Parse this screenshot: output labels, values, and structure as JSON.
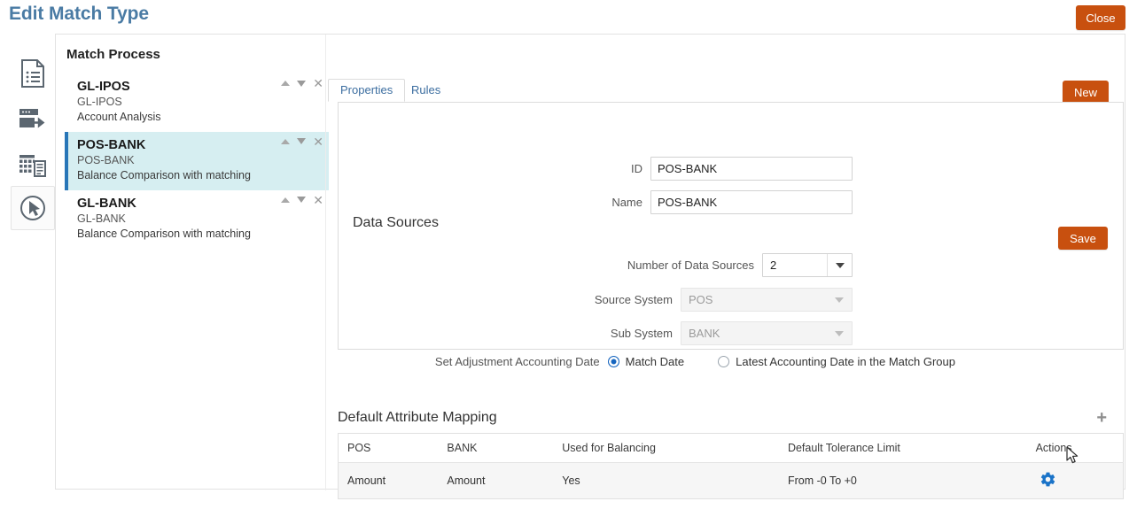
{
  "page": {
    "title": "Edit Match Type",
    "close_label": "Close"
  },
  "sidebar_rail": {
    "icons": [
      {
        "name": "document-list-icon"
      },
      {
        "name": "data-load-icon"
      },
      {
        "name": "grid-report-icon"
      },
      {
        "name": "cursor-target-icon"
      }
    ]
  },
  "match_process": {
    "heading": "Match Process",
    "new_label": "New",
    "items": [
      {
        "title": "GL-IPOS",
        "subtitle": "GL-IPOS",
        "description": "Account Analysis",
        "selected": false
      },
      {
        "title": "POS-BANK",
        "subtitle": "POS-BANK",
        "description": "Balance Comparison with matching",
        "selected": true
      },
      {
        "title": "GL-BANK",
        "subtitle": "GL-BANK",
        "description": "Balance Comparison with matching",
        "selected": false
      }
    ]
  },
  "tabs": [
    {
      "label": "Properties",
      "active": true
    },
    {
      "label": "Rules",
      "active": false
    }
  ],
  "properties": {
    "save_label": "Save",
    "id_label": "ID",
    "id_value": "POS-BANK",
    "name_label": "Name",
    "name_value": "POS-BANK",
    "data_sources_heading": "Data Sources",
    "number_of_data_sources_label": "Number of Data Sources",
    "number_of_data_sources_value": "2",
    "source_system_label": "Source System",
    "source_system_value": "POS",
    "sub_system_label": "Sub System",
    "sub_system_value": "BANK",
    "set_adjustment_label": "Set Adjustment Accounting Date",
    "radio_match_date": "Match Date",
    "radio_latest_accounting": "Latest Accounting Date in the Match Group",
    "selected_radio": "Match Date"
  },
  "default_attribute_mapping": {
    "title": "Default Attribute Mapping",
    "add_icon": "+",
    "columns": [
      "POS",
      "BANK",
      "Used for Balancing",
      "Default Tolerance Limit",
      "Actions"
    ],
    "rows": [
      {
        "pos": "Amount",
        "bank": "Amount",
        "used_for_balancing": "Yes",
        "default_tolerance_limit": "From -0 To +0",
        "action_icon": "gear-icon"
      }
    ]
  },
  "colors": {
    "accent_orange": "#c8500f",
    "title_blue": "#4a7ba4",
    "selection_cyan": "#d6eef1",
    "selection_border": "#2876b8",
    "gear_blue": "#1a73c8"
  }
}
